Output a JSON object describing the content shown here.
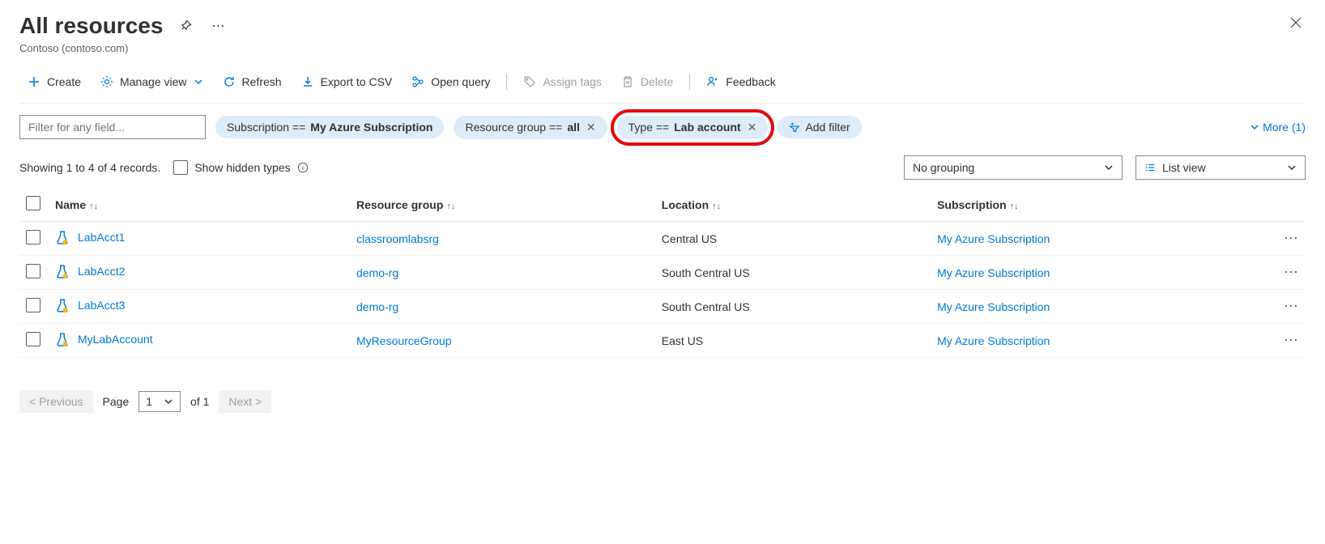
{
  "header": {
    "title": "All resources",
    "subtitle": "Contoso (contoso.com)"
  },
  "toolbar": {
    "create": "Create",
    "manage_view": "Manage view",
    "refresh": "Refresh",
    "export_csv": "Export to CSV",
    "open_query": "Open query",
    "assign_tags": "Assign tags",
    "delete": "Delete",
    "feedback": "Feedback"
  },
  "filters": {
    "placeholder": "Filter for any field...",
    "subscription_label": "Subscription == ",
    "subscription_value": "My Azure Subscription",
    "rg_label": "Resource group == ",
    "rg_value": "all",
    "type_label": "Type == ",
    "type_value": "Lab account",
    "add_filter": "Add filter",
    "more": "More (1)"
  },
  "status": {
    "showing": "Showing 1 to 4 of 4 records.",
    "show_hidden": "Show hidden types",
    "no_grouping": "No grouping",
    "list_view": "List view"
  },
  "columns": {
    "name": "Name",
    "rg": "Resource group",
    "location": "Location",
    "subscription": "Subscription"
  },
  "rows": [
    {
      "name": "LabAcct1",
      "rg": "classroomlabsrg",
      "location": "Central US",
      "subscription": "My Azure Subscription"
    },
    {
      "name": "LabAcct2",
      "rg": "demo-rg",
      "location": "South Central US",
      "subscription": "My Azure Subscription"
    },
    {
      "name": "LabAcct3",
      "rg": "demo-rg",
      "location": "South Central US",
      "subscription": "My Azure Subscription"
    },
    {
      "name": "MyLabAccount",
      "rg": "MyResourceGroup",
      "location": "East US",
      "subscription": "My Azure Subscription"
    }
  ],
  "pager": {
    "previous": "< Previous",
    "page_label": "Page",
    "page_num": "1",
    "of": "of 1",
    "next": "Next >"
  }
}
